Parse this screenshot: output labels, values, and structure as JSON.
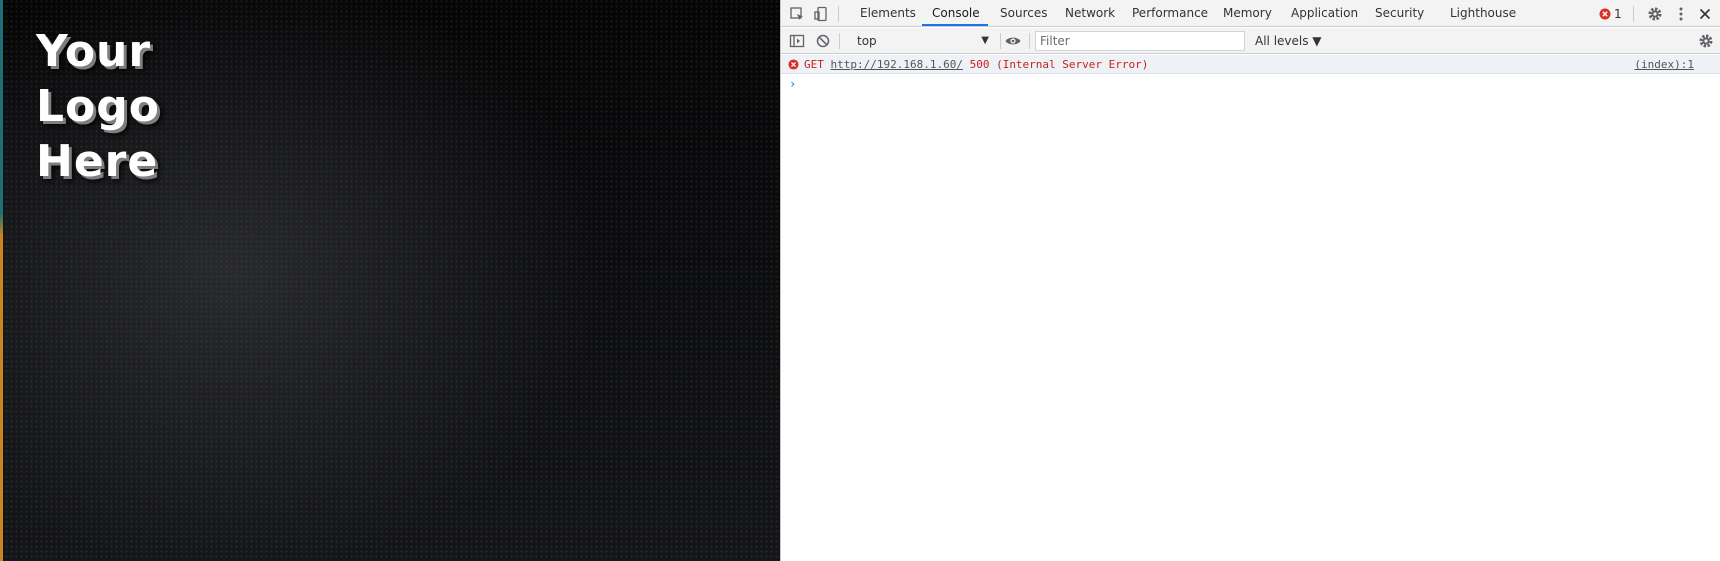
{
  "page": {
    "logo_lines": [
      "Your",
      "Logo",
      "Here"
    ]
  },
  "devtools": {
    "tabs": [
      {
        "label": "Elements"
      },
      {
        "label": "Console"
      },
      {
        "label": "Sources"
      },
      {
        "label": "Network"
      },
      {
        "label": "Performance"
      },
      {
        "label": "Memory"
      },
      {
        "label": "Application"
      },
      {
        "label": "Security"
      },
      {
        "label": "Lighthouse"
      }
    ],
    "active_tab": "Console",
    "error_count": "1",
    "toolbar": {
      "context": "top",
      "filter_placeholder": "Filter",
      "levels": "All levels ▼"
    },
    "console": {
      "messages": [
        {
          "level": "error",
          "method": "GET",
          "url": "http://192.168.1.60/",
          "status": "500 (Internal Server Error)",
          "source": "(index):1"
        }
      ],
      "prompt": "›"
    },
    "icons": {
      "inspect": "inspect-element-icon",
      "device": "device-toolbar-icon",
      "error": "error-circle-icon",
      "settings": "gear-icon",
      "menu": "kebab-menu-icon",
      "close": "close-icon",
      "sidebar": "show-sidebar-icon",
      "clear": "clear-console-icon",
      "live_expression": "eye-icon"
    },
    "colors": {
      "accent": "#1a73e8",
      "error": "#d93025",
      "error_text": "#c5221f"
    }
  }
}
